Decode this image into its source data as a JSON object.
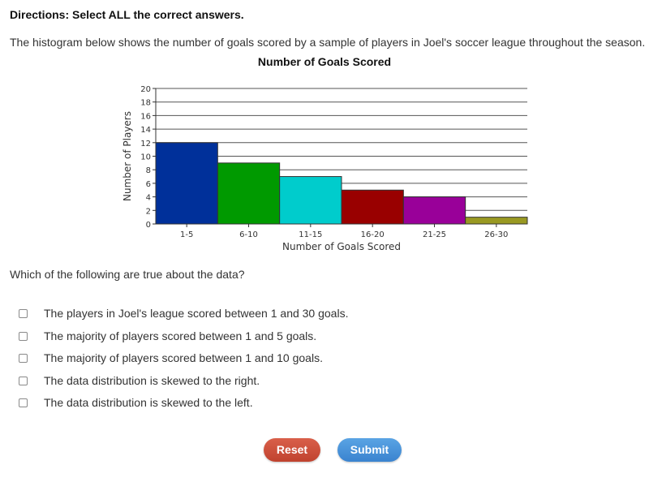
{
  "directions": "Directions: Select ALL the correct answers.",
  "prompt": "The histogram below shows the number of goals scored by a sample of players in Joel's soccer league throughout the season.",
  "question": "Which of the following are true about the data?",
  "options": [
    {
      "label": "The players in Joel's league scored between 1 and 30 goals.",
      "checked": false
    },
    {
      "label": "The majority of players scored between 1 and 5 goals.",
      "checked": false
    },
    {
      "label": "The majority of players scored between 1 and 10 goals.",
      "checked": false
    },
    {
      "label": "The data distribution is skewed to the right.",
      "checked": false
    },
    {
      "label": "The data distribution is skewed to the left.",
      "checked": false
    }
  ],
  "buttons": {
    "reset": "Reset",
    "submit": "Submit"
  },
  "chart_data": {
    "type": "bar",
    "title": "Number of Goals Scored",
    "xlabel": "Number of Goals Scored",
    "ylabel": "Number of Players",
    "categories": [
      "1-5",
      "6-10",
      "11-15",
      "16-20",
      "21-25",
      "26-30"
    ],
    "values": [
      12,
      9,
      7,
      5,
      4,
      1
    ],
    "colors": [
      "#00309a",
      "#009a00",
      "#00cccc",
      "#990000",
      "#990099",
      "#999922"
    ],
    "ylim": [
      0,
      20
    ],
    "yticks": [
      0,
      2,
      4,
      6,
      8,
      10,
      12,
      14,
      16,
      18,
      20
    ],
    "grid": true,
    "legend": "none"
  }
}
